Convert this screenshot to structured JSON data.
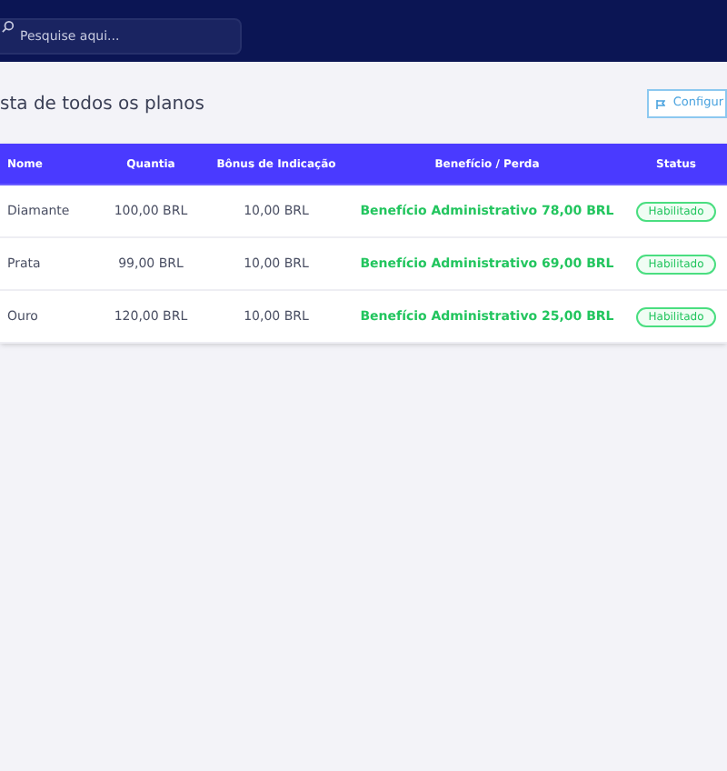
{
  "search": {
    "placeholder": "Pesquise aqui..."
  },
  "page_title": "sta de todos os planos",
  "config_button": "Configur",
  "table": {
    "columns": [
      "Nome",
      "Quantia",
      "Bônus de Indicação",
      "Benefício / Perda",
      "Status"
    ],
    "rows": [
      {
        "name": "Diamante",
        "amount": "100,00 BRL",
        "bonus": "10,00 BRL",
        "benefit": "Benefício Administrativo 78,00 BRL",
        "status": "Habilitado",
        "enabled": true
      },
      {
        "name": "Prata",
        "amount": "99,00 BRL",
        "bonus": "10,00 BRL",
        "benefit": "Benefício Administrativo 69,00 BRL",
        "status": "Habilitado",
        "enabled": true
      },
      {
        "name": "Ouro",
        "amount": "120,00 BRL",
        "bonus": "10,00 BRL",
        "benefit": "Benefício Administrativo 25,00 BRL",
        "status": "Habilitado",
        "enabled": true
      }
    ]
  }
}
